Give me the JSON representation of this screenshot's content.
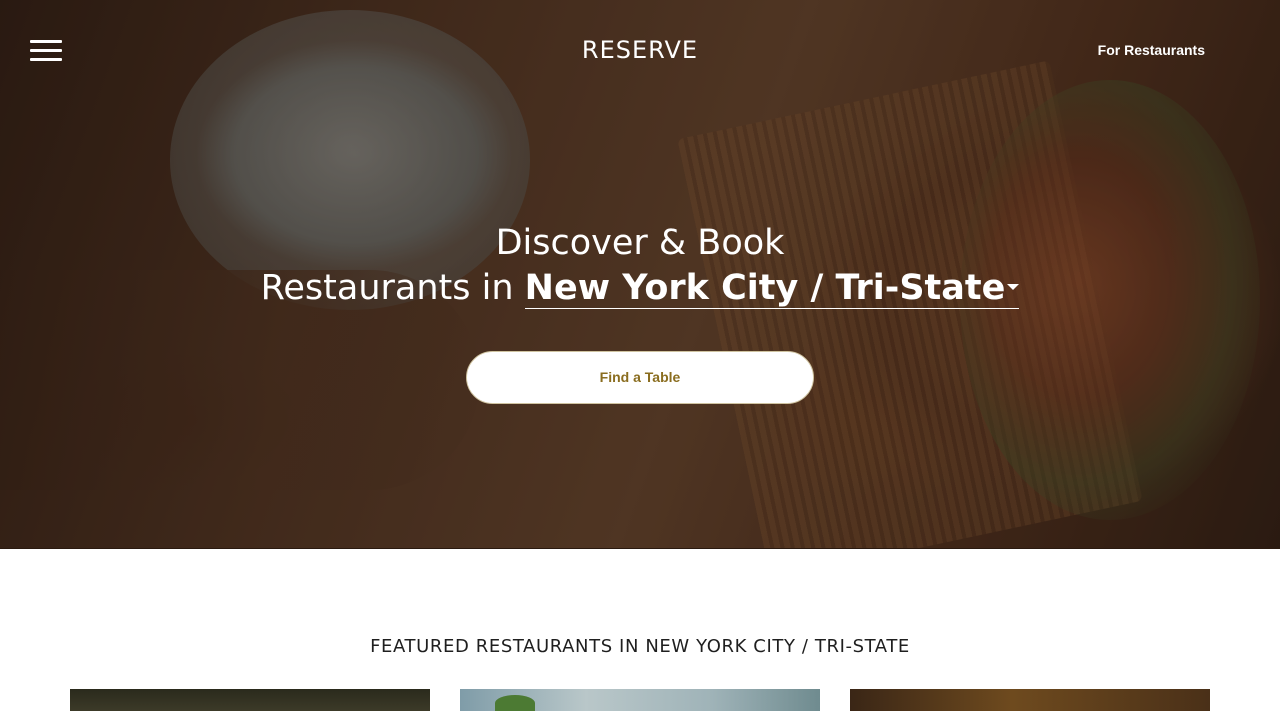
{
  "header": {
    "logo_text": "RESERVE",
    "for_restaurants_label": "For Restaurants"
  },
  "hero": {
    "headline_line1": "Discover & Book",
    "headline_prefix": "Restaurants in ",
    "city_selected": "New York City / Tri-State",
    "find_table_label": "Find a Table"
  },
  "featured": {
    "title": "FEATURED RESTAURANTS IN NEW YORK CITY / TRI-STATE",
    "cards_visible": 3
  },
  "colors": {
    "accent_gold": "#8a6d1f",
    "hero_text": "#ffffff",
    "body_text": "#1f1f1f"
  },
  "icons": {
    "menu": "hamburger-menu-icon",
    "city_dropdown": "caret-down-icon"
  }
}
